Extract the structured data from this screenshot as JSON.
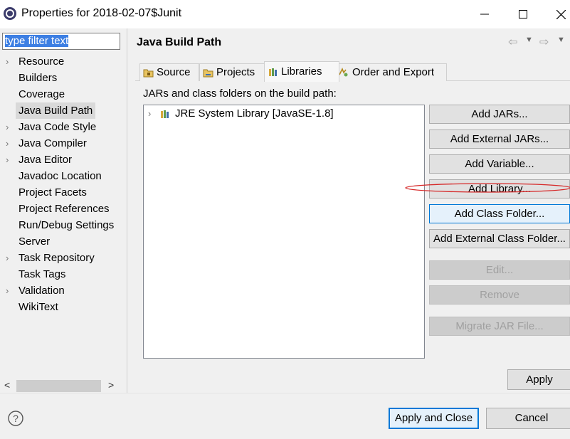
{
  "window": {
    "title": "Properties for 2018-02-07$Junit",
    "minimize_glyph": "—",
    "maximize_glyph": "☐",
    "close_glyph": "✕"
  },
  "sidebar": {
    "filter_placeholder": "type filter text",
    "items": [
      {
        "label": "Resource",
        "expandable": true
      },
      {
        "label": "Builders",
        "expandable": false
      },
      {
        "label": "Coverage",
        "expandable": false
      },
      {
        "label": "Java Build Path",
        "expandable": false,
        "selected": true
      },
      {
        "label": "Java Code Style",
        "expandable": true
      },
      {
        "label": "Java Compiler",
        "expandable": true
      },
      {
        "label": "Java Editor",
        "expandable": true
      },
      {
        "label": "Javadoc Location",
        "expandable": false
      },
      {
        "label": "Project Facets",
        "expandable": false
      },
      {
        "label": "Project References",
        "expandable": false
      },
      {
        "label": "Run/Debug Settings",
        "expandable": false
      },
      {
        "label": "Server",
        "expandable": false
      },
      {
        "label": "Task Repository",
        "expandable": true
      },
      {
        "label": "Task Tags",
        "expandable": false
      },
      {
        "label": "Validation",
        "expandable": true
      },
      {
        "label": "WikiText",
        "expandable": false
      }
    ],
    "scroll_left": "<",
    "scroll_right": ">"
  },
  "page": {
    "title": "Java Build Path",
    "history": {
      "back": "⇦",
      "forward": "⇨",
      "menu": "▼"
    }
  },
  "tabs": [
    {
      "label": "Source",
      "icon": "source-folder-icon"
    },
    {
      "label": "Projects",
      "icon": "projects-icon"
    },
    {
      "label": "Libraries",
      "icon": "libraries-icon",
      "active": true
    },
    {
      "label": "Order and Export",
      "icon": "order-export-icon"
    }
  ],
  "libraries": {
    "description": "JARs and class folders on the build path:",
    "tree": [
      {
        "label": "JRE System Library [JavaSE-1.8]",
        "icon": "library-icon",
        "expandable": true
      }
    ],
    "buttons": {
      "add_jars": "Add JARs...",
      "add_external_jars": "Add External JARs...",
      "add_variable": "Add Variable...",
      "add_library": "Add Library...",
      "add_class_folder": "Add Class Folder...",
      "add_external_class_folder": "Add External Class Folder...",
      "edit": "Edit...",
      "remove": "Remove",
      "migrate_jar": "Migrate JAR File..."
    },
    "annotation_color": "#d62828"
  },
  "footer": {
    "apply": "Apply",
    "apply_and_close": "Apply and Close",
    "cancel": "Cancel",
    "help_glyph": "?"
  }
}
